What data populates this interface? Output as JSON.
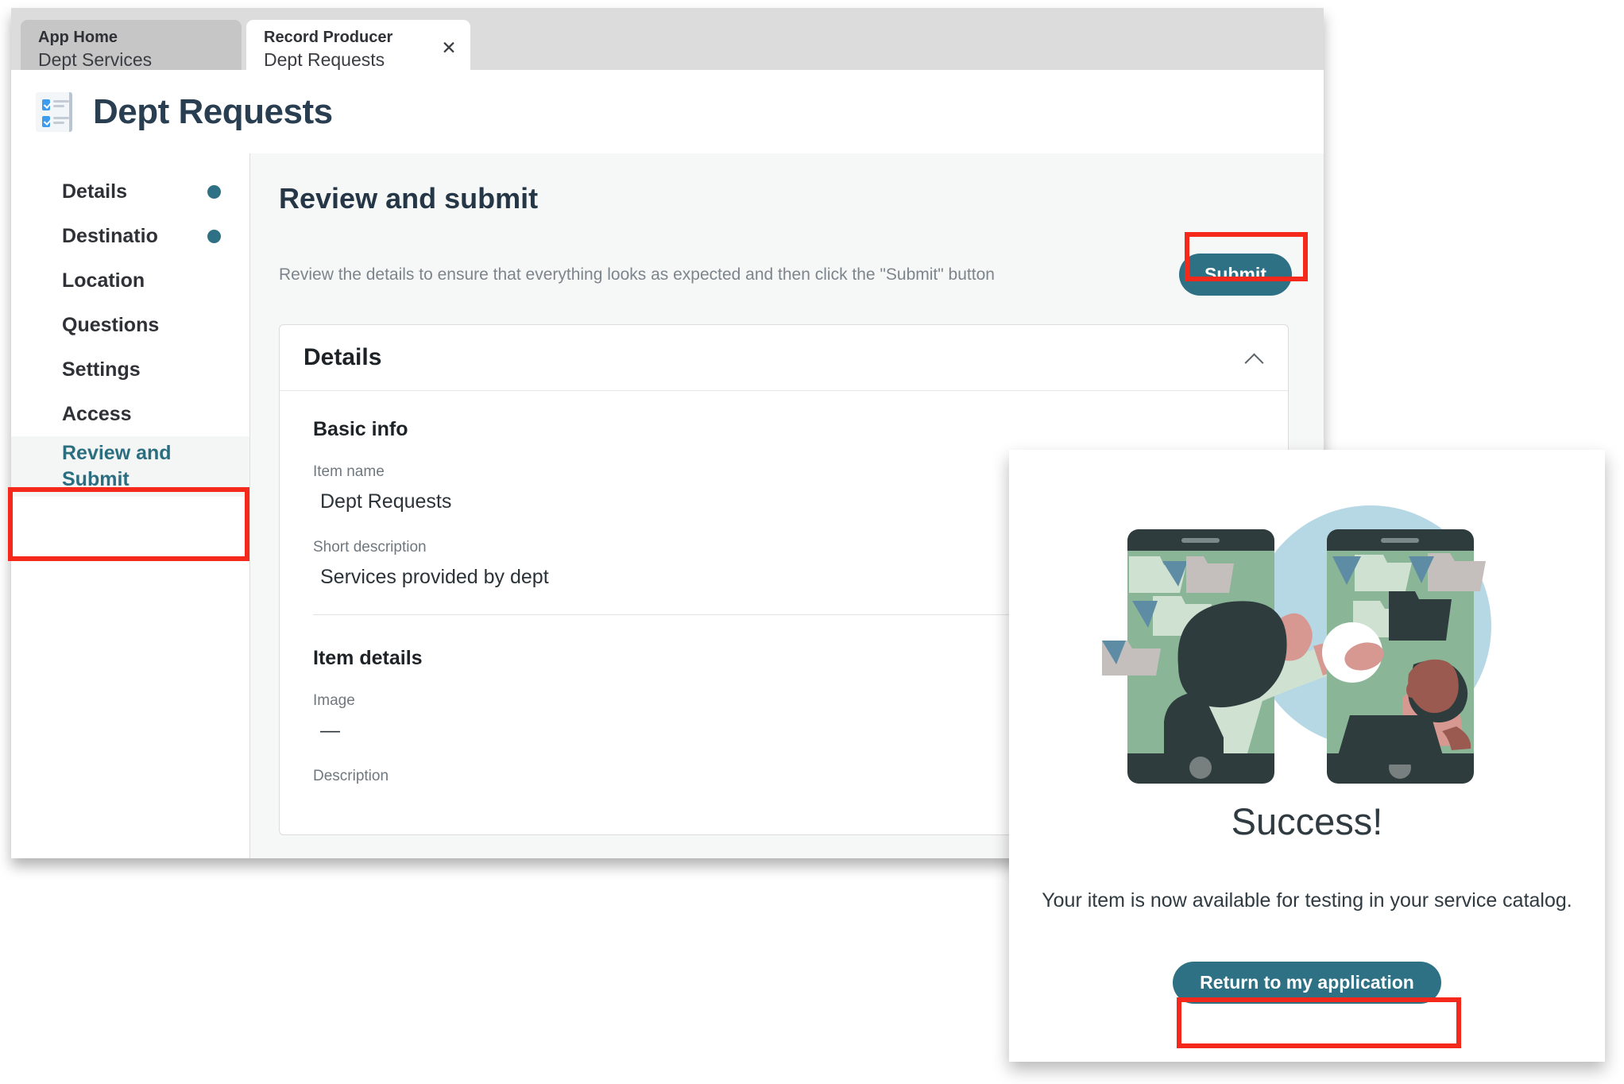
{
  "browser": {
    "tabs": [
      {
        "kicker": "App Home",
        "title": "Dept Services",
        "active": false
      },
      {
        "kicker": "Record Producer",
        "title": "Dept Requests",
        "active": true,
        "close": "✕"
      }
    ]
  },
  "app": {
    "icon": "checklist-form-icon",
    "title": "Dept Requests"
  },
  "sidebar": {
    "items": [
      {
        "label": "Details",
        "dot": true,
        "active": false
      },
      {
        "label": "Destinatio",
        "dot": true,
        "active": false
      },
      {
        "label": "Location",
        "dot": false,
        "active": false
      },
      {
        "label": "Questions",
        "dot": false,
        "active": false
      },
      {
        "label": "Settings",
        "dot": false,
        "active": false
      },
      {
        "label": "Access",
        "dot": false,
        "active": false
      },
      {
        "label": "Review and\nSubmit",
        "dot": false,
        "active": true
      }
    ]
  },
  "main": {
    "heading": "Review and submit",
    "subtext": "Review the details to ensure that everything looks as expected and then click the \"Submit\" button",
    "submit_label": "Submit",
    "card": {
      "title": "Details",
      "collapse_icon": "chevron-up-icon",
      "sections": [
        {
          "title": "Basic info",
          "fields": [
            {
              "label": "Item name",
              "value": "Dept Requests"
            },
            {
              "label": "Short description",
              "value": "Services provided by dept"
            }
          ]
        },
        {
          "title": "Item details",
          "fields": [
            {
              "label": "Image",
              "value": "—"
            },
            {
              "label": "Description",
              "value": ""
            }
          ]
        }
      ]
    }
  },
  "modal": {
    "illustration": "two-people-phones-sync-illustration",
    "title": "Success!",
    "message": "Your item is now available for testing in your service catalog.",
    "button_label": "Return to my application"
  },
  "colors": {
    "accent_teal": "#2e7184",
    "highlight_red": "#f5291b",
    "active_nav_text": "#2a6e80",
    "page_bg": "#f6f7f7",
    "illustration_circle": "#b6d8e4",
    "illustration_phone_screen": "#8ab597",
    "illustration_phone_frame": "#2e3c3e"
  },
  "annotations": {
    "highlight_targets": [
      "sidebar-item-review-and-submit",
      "submit-button",
      "return-to-my-application-button"
    ]
  }
}
